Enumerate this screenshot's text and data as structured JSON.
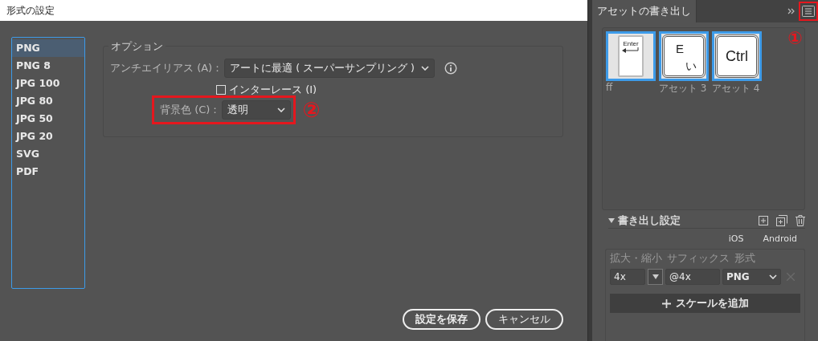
{
  "dialog": {
    "title": "形式の設定",
    "formats": [
      {
        "label": "PNG",
        "selected": true
      },
      {
        "label": "PNG 8",
        "selected": false
      },
      {
        "label": "JPG 100",
        "selected": false
      },
      {
        "label": "JPG 80",
        "selected": false
      },
      {
        "label": "JPG 50",
        "selected": false
      },
      {
        "label": "JPG 20",
        "selected": false
      },
      {
        "label": "SVG",
        "selected": false
      },
      {
        "label": "PDF",
        "selected": false
      }
    ],
    "options": {
      "legend": "オプション",
      "antialias": {
        "label": "アンチエイリアス (A)：",
        "value": "アートに最適 ( スーパーサンプリング )"
      },
      "interlace": {
        "label": "インターレース (I)",
        "checked": false
      },
      "background": {
        "label": "背景色 (C)：",
        "value": "透明",
        "highlighted": true,
        "callout": "②"
      }
    },
    "buttons": [
      {
        "label": "設定を保存",
        "kind": "primary"
      },
      {
        "label": "キャンセル",
        "kind": "secondary"
      }
    ]
  },
  "panel": {
    "title": "アセットの書き出し",
    "menu_highlighted": true,
    "callout": "①",
    "assets": [
      {
        "name": "ff",
        "kind": "enter",
        "key_labels": [
          "Enter"
        ],
        "selected": true
      },
      {
        "name": "アセット 3",
        "kind": "kana",
        "key_labels": [
          "E",
          "い"
        ],
        "selected": true
      },
      {
        "name": "アセット 4",
        "kind": "plain",
        "key_labels": [
          "Ctrl"
        ],
        "selected": true
      }
    ],
    "settings": {
      "title": "書き出し設定",
      "expanded": true,
      "platforms": [
        "iOS",
        "Android"
      ],
      "columns": [
        "拡大・縮小",
        "サフィックス",
        "形式"
      ],
      "rows": [
        {
          "scale": "4x",
          "suffix": "@4x",
          "format": "PNG"
        }
      ],
      "add_label": "スケールを追加"
    }
  }
}
